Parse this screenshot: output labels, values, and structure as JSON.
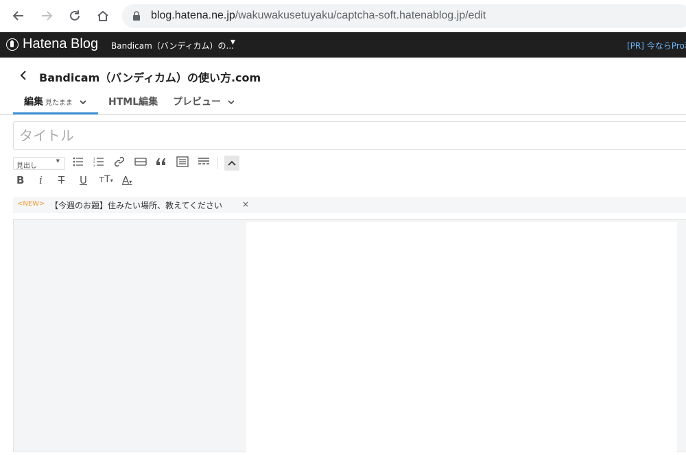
{
  "browser": {
    "url_host": "blog.hatena.ne.jp",
    "url_path": "/wakuwakusetuyaku/captcha-soft.hatenablog.jp/edit"
  },
  "hatena_bar": {
    "logo_text": "Hatena Blog",
    "blog_name": "Bandicam（バンディカム）の...",
    "pr_text": "[PR] 今ならPro利"
  },
  "editor_header": {
    "blog_title": "Bandicam（バンディカム）の使い方.com"
  },
  "tabs": [
    {
      "label": "編集",
      "sub": "見たまま"
    },
    {
      "label": "HTML編集"
    },
    {
      "label": "プレビュー"
    }
  ],
  "title_input": {
    "placeholder": "タイトル",
    "value": ""
  },
  "toolbar": {
    "heading_select": "見出し",
    "format_bold": "B",
    "format_italic": "i",
    "format_strike": "T",
    "format_underline": "U",
    "format_size": "тT",
    "format_color": "A"
  },
  "notice": {
    "badge": "<NEW>",
    "text": "【今週のお題】住みたい場所、教えてください",
    "close": "×"
  },
  "colors": {
    "hatena_bar": "#1f1f1f",
    "accent": "#3b8dd6",
    "new_badge": "#f29b2f",
    "pr_link": "#6eb8ff"
  }
}
